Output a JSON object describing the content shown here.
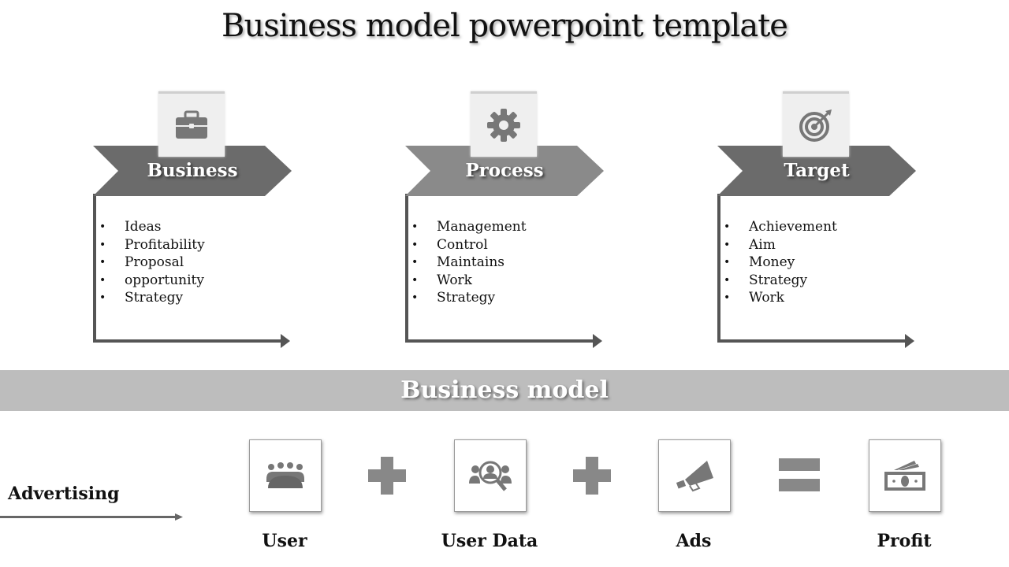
{
  "title": "Business model powerpoint template",
  "colors": {
    "chevron_dark": "#6b6b6b",
    "chevron_mid": "#8a8a8a",
    "icon_gray": "#777777",
    "band": "#bdbdbd"
  },
  "cards": [
    {
      "label": "Business",
      "icon": "briefcase-icon",
      "items": [
        "Ideas",
        "Profitability",
        "Proposal",
        "opportunity",
        "Strategy"
      ]
    },
    {
      "label": "Process",
      "icon": "gear-icon",
      "items": [
        "Management",
        "Control",
        "Maintains",
        "Work",
        "Strategy"
      ]
    },
    {
      "label": "Target",
      "icon": "target-icon",
      "items": [
        "Achievement",
        "Aim",
        "Money",
        "Strategy",
        "Work"
      ]
    }
  ],
  "band": {
    "label": "Business model"
  },
  "advertising": {
    "label": "Advertising"
  },
  "equation": {
    "tiles": [
      {
        "label": "User",
        "icon": "group-icon"
      },
      {
        "label": "User Data",
        "icon": "user-search-icon"
      },
      {
        "label": "Ads",
        "icon": "megaphone-icon"
      },
      {
        "label": "Profit",
        "icon": "money-icon"
      }
    ],
    "operators": [
      "plus",
      "plus",
      "equals"
    ]
  }
}
